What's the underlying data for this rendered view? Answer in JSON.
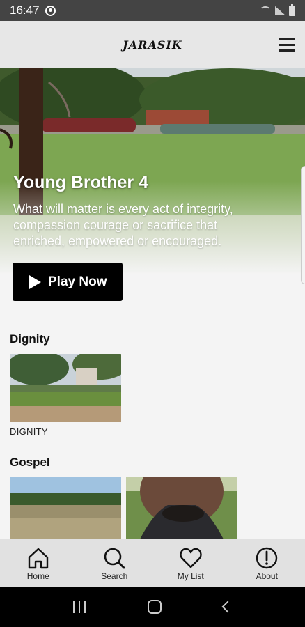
{
  "status_bar": {
    "time": "16:47"
  },
  "header": {
    "logo": "JARASIK"
  },
  "hero": {
    "title": "Young Brother 4",
    "description": "What will matter is every act of integrity, compassion courage or sacrifice that enriched, empowered or encouraged.",
    "play_label": "Play Now"
  },
  "sections": [
    {
      "title": "Dignity",
      "items": [
        {
          "caption": "DIGNITY"
        }
      ]
    },
    {
      "title": "Gospel",
      "items": [
        {
          "caption": ""
        },
        {
          "caption": ""
        }
      ]
    }
  ],
  "bottom_nav": [
    {
      "label": "Home",
      "icon": "home-icon"
    },
    {
      "label": "Search",
      "icon": "search-icon"
    },
    {
      "label": "My List",
      "icon": "heart-icon"
    },
    {
      "label": "About",
      "icon": "info-icon"
    }
  ]
}
